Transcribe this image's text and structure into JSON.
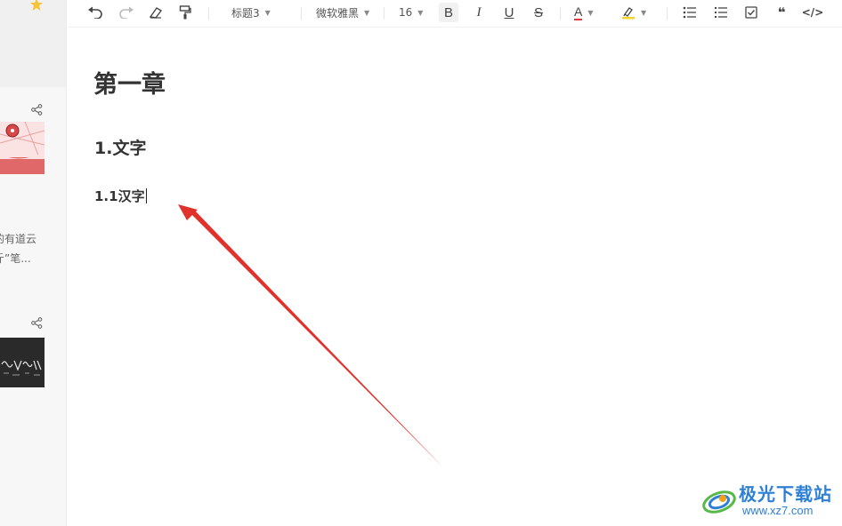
{
  "sidebar": {
    "snippet_line1": "的有道云",
    "snippet_line2": "斤”笔..."
  },
  "toolbar": {
    "heading_style": "标题3",
    "font_family": "微软雅黑",
    "font_size": "16",
    "bold_label": "B",
    "italic_label": "I",
    "underline_label": "U",
    "strike_label": "S",
    "font_color_label": "A",
    "font_color": "#e03a3a",
    "highlight_color": "#f5d42a",
    "quote_label": "❝",
    "code_label": "</>"
  },
  "document": {
    "h1": "第一章",
    "h2": "1.文字",
    "h3": "1.1汉字"
  },
  "watermark": {
    "title": "极光下载站",
    "url": "www.xz7.com"
  },
  "colors": {
    "arrow": "#e0322b",
    "watermark": "#2e7fd6"
  }
}
